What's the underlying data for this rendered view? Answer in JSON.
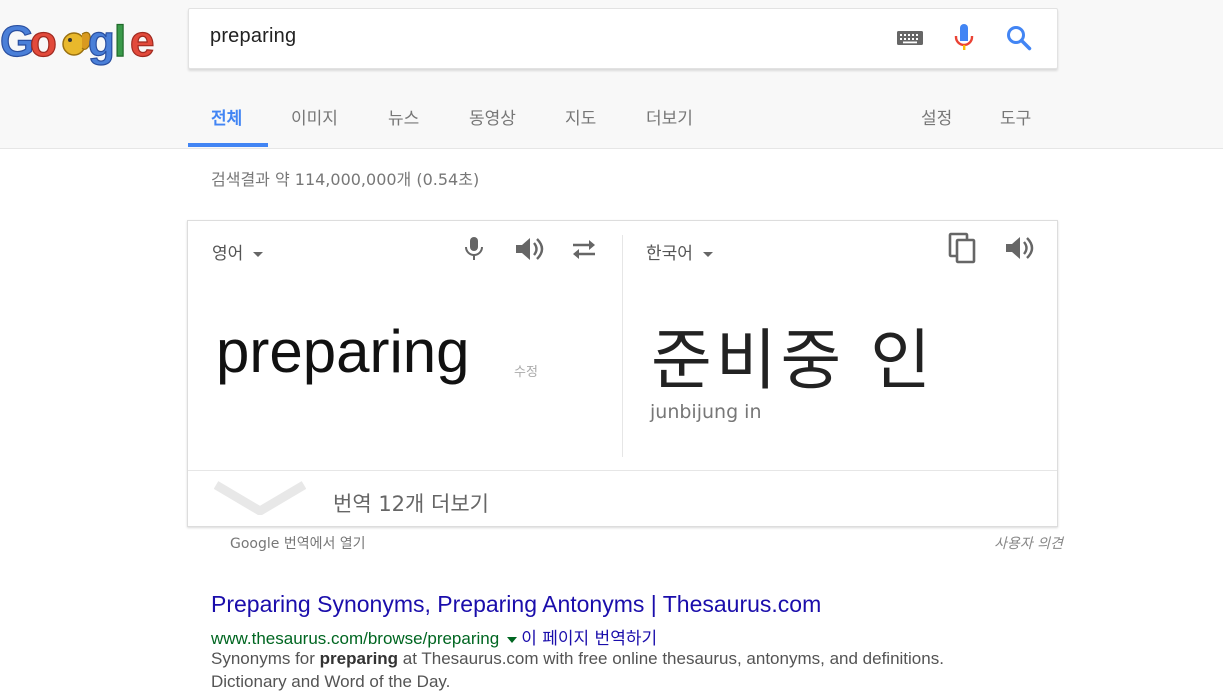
{
  "search": {
    "query": "preparing"
  },
  "tabs": [
    "전체",
    "이미지",
    "뉴스",
    "동영상",
    "지도",
    "더보기"
  ],
  "tools": [
    "설정",
    "도구"
  ],
  "result_stats": "검색결과 약 114,000,000개 (0.54초)",
  "translate": {
    "source_lang": "영어",
    "target_lang": "한국어",
    "source_text": "preparing",
    "edit_label": "수정",
    "target_text": "준비중 인",
    "romanization": "junbijung in",
    "more_label": "번역 12개 더보기",
    "open_in_google": "Google 번역에서 열기",
    "feedback": "사용자 의견"
  },
  "result": {
    "title": "Preparing Synonyms, Preparing Antonyms | Thesaurus.com",
    "url": "www.thesaurus.com/browse/preparing",
    "translate_page": "이 페이지 번역하기",
    "snippet_before": "Synonyms for ",
    "snippet_bold": "preparing",
    "snippet_after": " at Thesaurus.com with free online thesaurus, antonyms, and definitions.",
    "snippet_cut": "Dictionary and Word of the Day."
  },
  "colors": {
    "link": "#1a0dab",
    "url": "#006621",
    "accent": "#4285f4"
  }
}
